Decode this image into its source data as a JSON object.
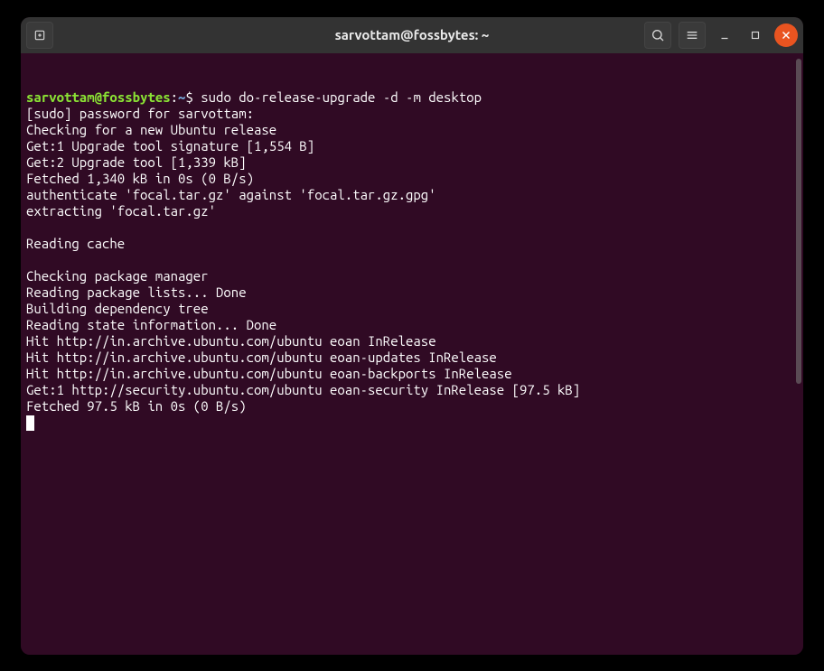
{
  "window": {
    "title": "sarvottam@fossbytes: ~"
  },
  "prompt": {
    "user": "sarvottam",
    "host": "fossbytes",
    "path": "~",
    "symbol": "$"
  },
  "command": "sudo do-release-upgrade -d -m desktop",
  "output_lines": [
    "[sudo] password for sarvottam:",
    "Checking for a new Ubuntu release",
    "Get:1 Upgrade tool signature [1,554 B]",
    "Get:2 Upgrade tool [1,339 kB]",
    "Fetched 1,340 kB in 0s (0 B/s)",
    "authenticate 'focal.tar.gz' against 'focal.tar.gz.gpg'",
    "extracting 'focal.tar.gz'",
    "",
    "Reading cache",
    "",
    "Checking package manager",
    "Reading package lists... Done",
    "Building dependency tree",
    "Reading state information... Done",
    "Hit http://in.archive.ubuntu.com/ubuntu eoan InRelease",
    "Hit http://in.archive.ubuntu.com/ubuntu eoan-updates InRelease",
    "Hit http://in.archive.ubuntu.com/ubuntu eoan-backports InRelease",
    "Get:1 http://security.ubuntu.com/ubuntu eoan-security InRelease [97.5 kB]",
    "Fetched 97.5 kB in 0s (0 B/s)"
  ]
}
